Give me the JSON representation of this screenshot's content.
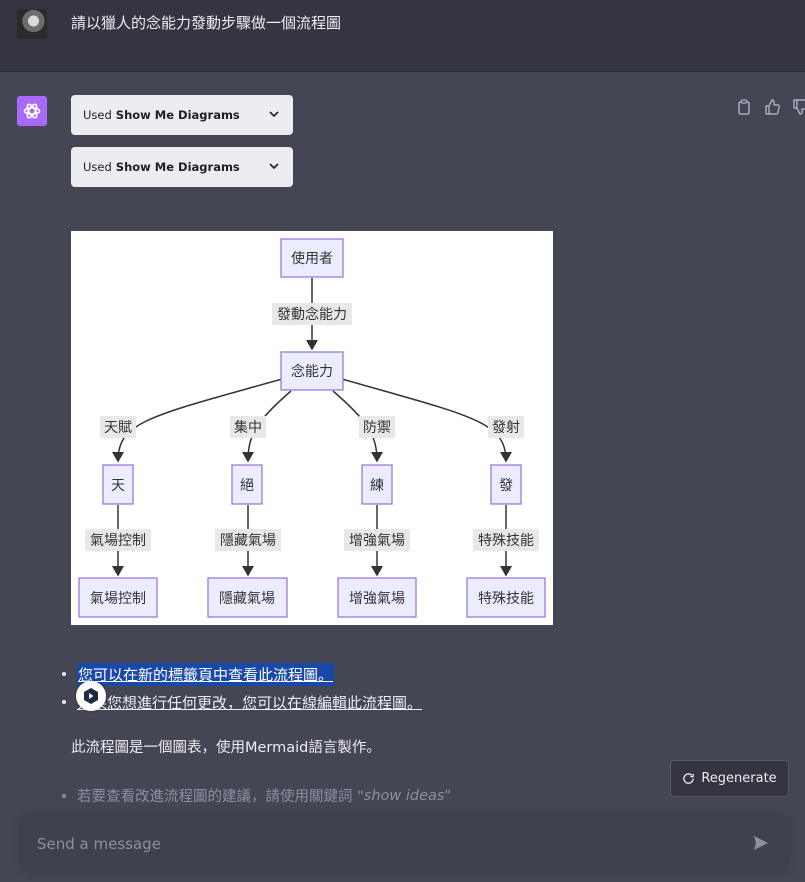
{
  "user": {
    "message": "請以獵人的念能力發動步驟做一個流程圖"
  },
  "assistant": {
    "tools": [
      {
        "prefix": "Used",
        "name": "Show Me Diagrams"
      },
      {
        "prefix": "Used",
        "name": "Show Me Diagrams"
      }
    ],
    "diagram": {
      "root": "使用者",
      "root_edge": "發動念能力",
      "center": "念能力",
      "branches": [
        {
          "edge": "天賦",
          "node": "天",
          "sub_edge": "氣場控制",
          "leaf": "氣場控制"
        },
        {
          "edge": "集中",
          "node": "絕",
          "sub_edge": "隱藏氣場",
          "leaf": "隱藏氣場"
        },
        {
          "edge": "防禦",
          "node": "練",
          "sub_edge": "增強氣場",
          "leaf": "增強氣場"
        },
        {
          "edge": "發射",
          "node": "發",
          "sub_edge": "特殊技能",
          "leaf": "特殊技能"
        }
      ]
    },
    "links": {
      "view_new_tab": "您可以在新的標籤頁中查看此流程圖。",
      "edit_online": "如果您想進行任何更改，您可以在線編輯此流程圖。"
    },
    "paragraph": "此流程圖是一個圖表，使用Mermaid語言製作。",
    "tip_prefix": "若要查看改進流程圖的建議，請使用關鍵詞 \"",
    "tip_keyword": "show ideas",
    "tip_suffix": "\""
  },
  "regenerate_label": "Regenerate",
  "composer": {
    "placeholder": "Send a message"
  }
}
